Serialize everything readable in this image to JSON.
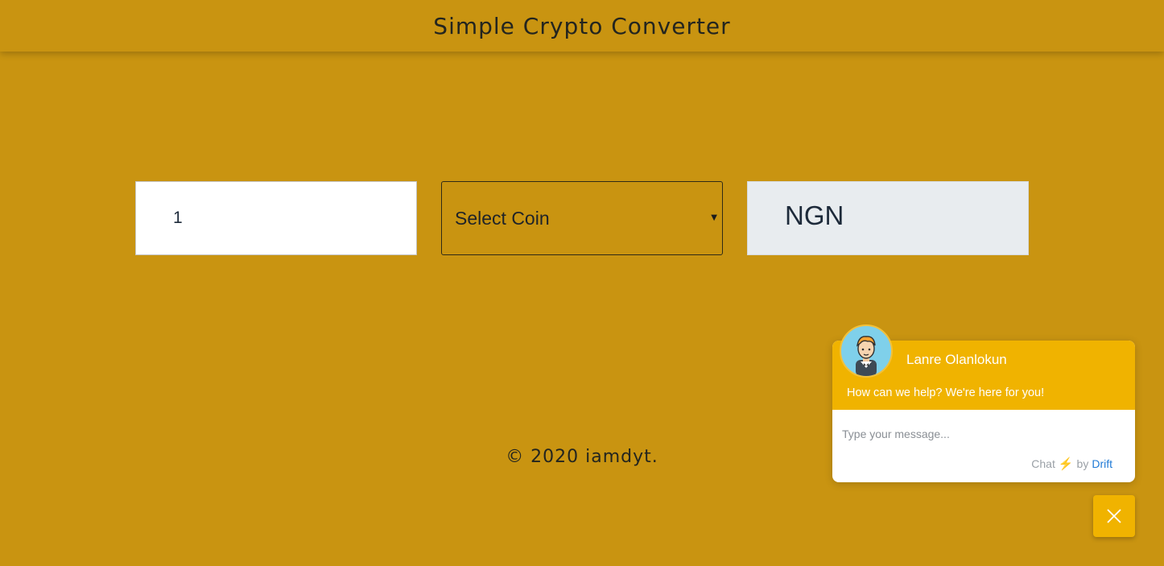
{
  "header": {
    "title": "Simple Crypto Converter"
  },
  "converter": {
    "amount_value": "1",
    "coin_select_label": "Select Coin",
    "currency_label": "NGN"
  },
  "footer": {
    "copyright": "© 2020 iamdyt."
  },
  "chat": {
    "agent_name": "Lanre Olanlokun",
    "greeting": "How can we help? We're here for you!",
    "message_placeholder": "Type your message...",
    "credit_prefix": "Chat",
    "credit_by": "by",
    "credit_brand": "Drift",
    "icons": {
      "avatar": "agent-avatar-icon",
      "bolt": "lightning-bolt-icon",
      "close": "close-icon"
    }
  },
  "colors": {
    "page_background": "#c99411",
    "chat_accent": "#f0b300",
    "currency_box": "#e8ecef",
    "drift_link": "#1f7ad6"
  }
}
